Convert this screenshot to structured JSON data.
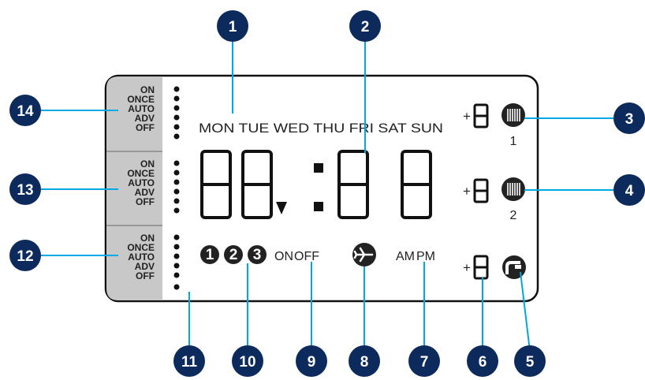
{
  "colors": {
    "callout": "#0d2a5c",
    "leader": "#00a8e1",
    "panel": "#c8c8c8",
    "ink": "#222222"
  },
  "mode_list": [
    "ON",
    "ONCE",
    "AUTO",
    "ADV",
    "OFF"
  ],
  "days": "MON TUE WED THU FRI SAT SUN",
  "channels": [
    "1",
    "2",
    "3"
  ],
  "on_label": "ON",
  "off_label": "OFF",
  "am_label": "AM",
  "pm_label": "PM",
  "plus_sign": "+",
  "zone_labels": [
    "1",
    "2"
  ],
  "callouts": [
    "1",
    "2",
    "3",
    "4",
    "5",
    "6",
    "7",
    "8",
    "9",
    "10",
    "11",
    "12",
    "13",
    "14"
  ],
  "icons": [
    "radiator-icon",
    "radiator-icon",
    "hot-water-tap-icon",
    "airplane-holiday-icon"
  ]
}
